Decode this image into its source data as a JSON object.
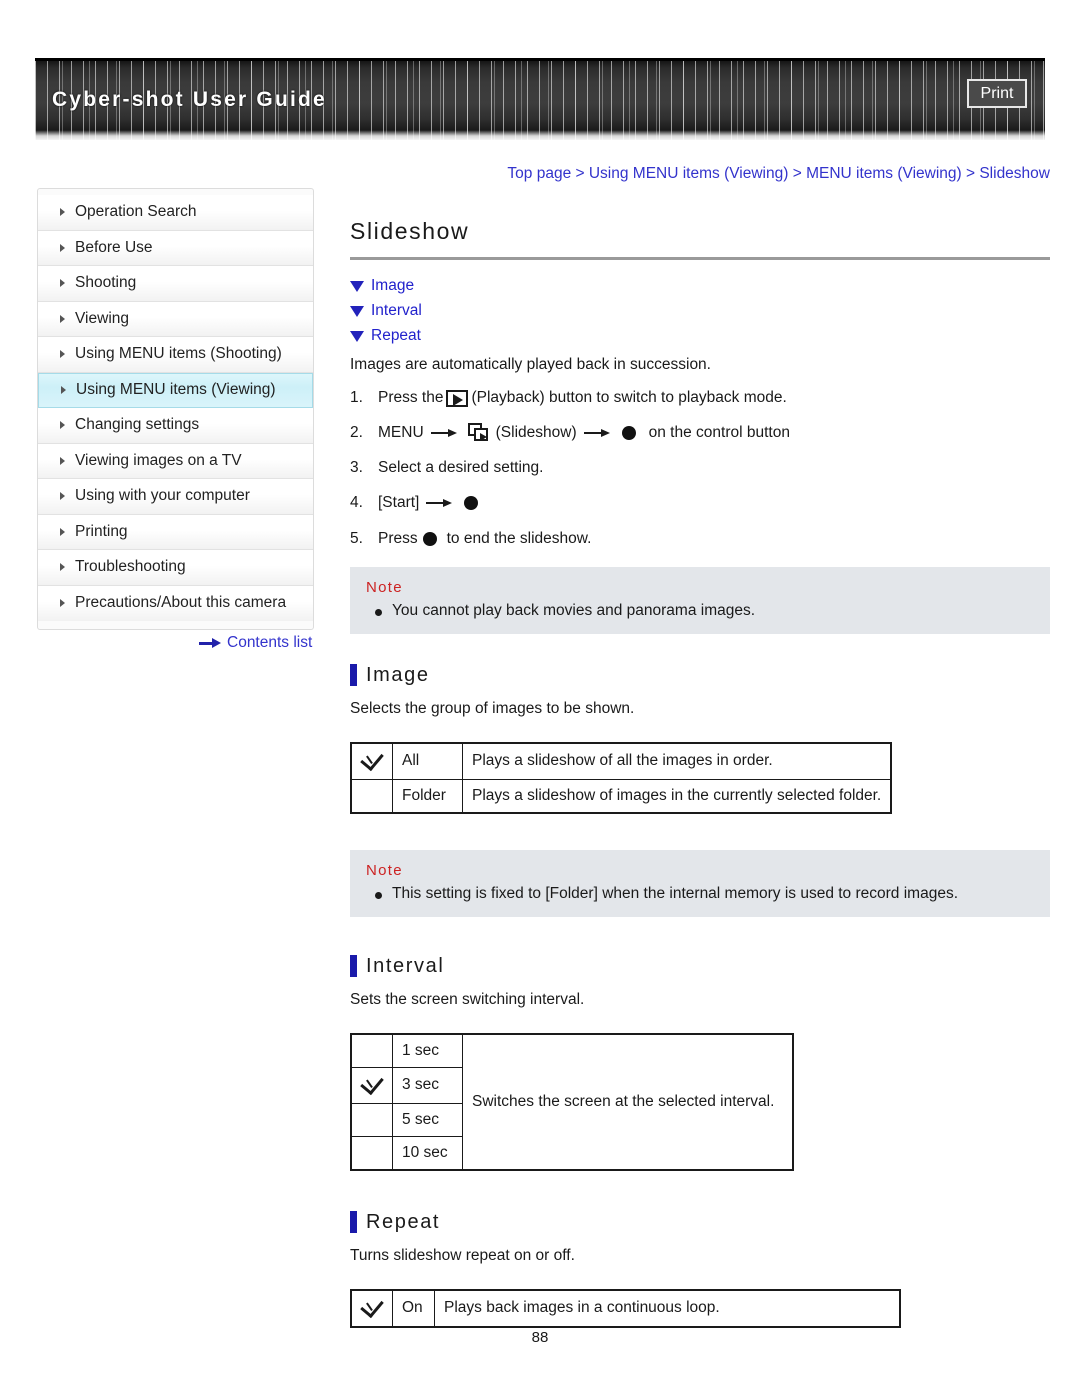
{
  "header": {
    "title": "Cyber-shot User Guide",
    "print_label": "Print"
  },
  "breadcrumb": {
    "full": "Top page > Using MENU items (Viewing) > MENU items (Viewing) > Slideshow",
    "items": [
      "Top page",
      "Using MENU items (Viewing)",
      "MENU items (Viewing)",
      "Slideshow"
    ]
  },
  "sidebar": {
    "items": [
      {
        "label": "Operation Search",
        "active": false
      },
      {
        "label": "Before Use",
        "active": false
      },
      {
        "label": "Shooting",
        "active": false
      },
      {
        "label": "Viewing",
        "active": false
      },
      {
        "label": "Using MENU items (Shooting)",
        "active": false
      },
      {
        "label": "Using MENU items (Viewing)",
        "active": true
      },
      {
        "label": "Changing settings",
        "active": false
      },
      {
        "label": "Viewing images on a TV",
        "active": false
      },
      {
        "label": "Using with your computer",
        "active": false
      },
      {
        "label": "Printing",
        "active": false
      },
      {
        "label": "Troubleshooting",
        "active": false
      },
      {
        "label": "Precautions/About this camera",
        "active": false
      }
    ],
    "contents_link": "Contents list"
  },
  "main": {
    "title": "Slideshow",
    "jump_links": [
      "Image",
      "Interval",
      "Repeat"
    ],
    "lead": "Images are automatically played back in succession.",
    "steps": [
      {
        "num": "1.",
        "pre": "Press the",
        "icon": "playback-icon",
        "post": "(Playback) button to switch to playback mode."
      },
      {
        "num": "2.",
        "pre": "MENU",
        "icon": "slideshow-icon",
        "mid": "(Slideshow)",
        "post": "on the control button"
      },
      {
        "num": "3.",
        "pre": "Select a desired setting.",
        "icon": "",
        "post": ""
      },
      {
        "num": "4.",
        "pre": "[Start]",
        "icon": "",
        "post": ""
      },
      {
        "num": "5.",
        "pre": "Press",
        "icon": "",
        "post": "to end the slideshow."
      }
    ],
    "note1": {
      "heading": "Note",
      "text": "You cannot play back movies and panorama images."
    },
    "section_image": {
      "heading": "Image",
      "desc": "Selects the group of images to be shown.",
      "rows": [
        {
          "checked": true,
          "label": "All",
          "desc": "Plays a slideshow of all the images in order."
        },
        {
          "checked": false,
          "label": "Folder",
          "desc": "Plays a slideshow of images in the currently selected folder."
        }
      ]
    },
    "note2": {
      "heading": "Note",
      "text": "This setting is fixed to [Folder] when the internal memory is used to record images."
    },
    "section_interval": {
      "heading": "Interval",
      "desc": "Sets the screen switching interval.",
      "shared_desc": "Switches the screen at the selected interval.",
      "rows": [
        {
          "checked": false,
          "label": "1 sec"
        },
        {
          "checked": true,
          "label": "3 sec"
        },
        {
          "checked": false,
          "label": "5 sec"
        },
        {
          "checked": false,
          "label": "10 sec"
        }
      ]
    },
    "section_repeat": {
      "heading": "Repeat",
      "desc": "Turns slideshow repeat on or off.",
      "rows": [
        {
          "checked": true,
          "label": "On",
          "desc": "Plays back images in a continuous loop."
        }
      ]
    }
  },
  "footer": {
    "page_number": "88"
  },
  "colors": {
    "link": "#3333cc",
    "accent_bar": "#1a1aaa",
    "note_bg": "#e3e6ea",
    "note_heading": "#cc2222",
    "sidebar_active": "#cdf0f8"
  }
}
